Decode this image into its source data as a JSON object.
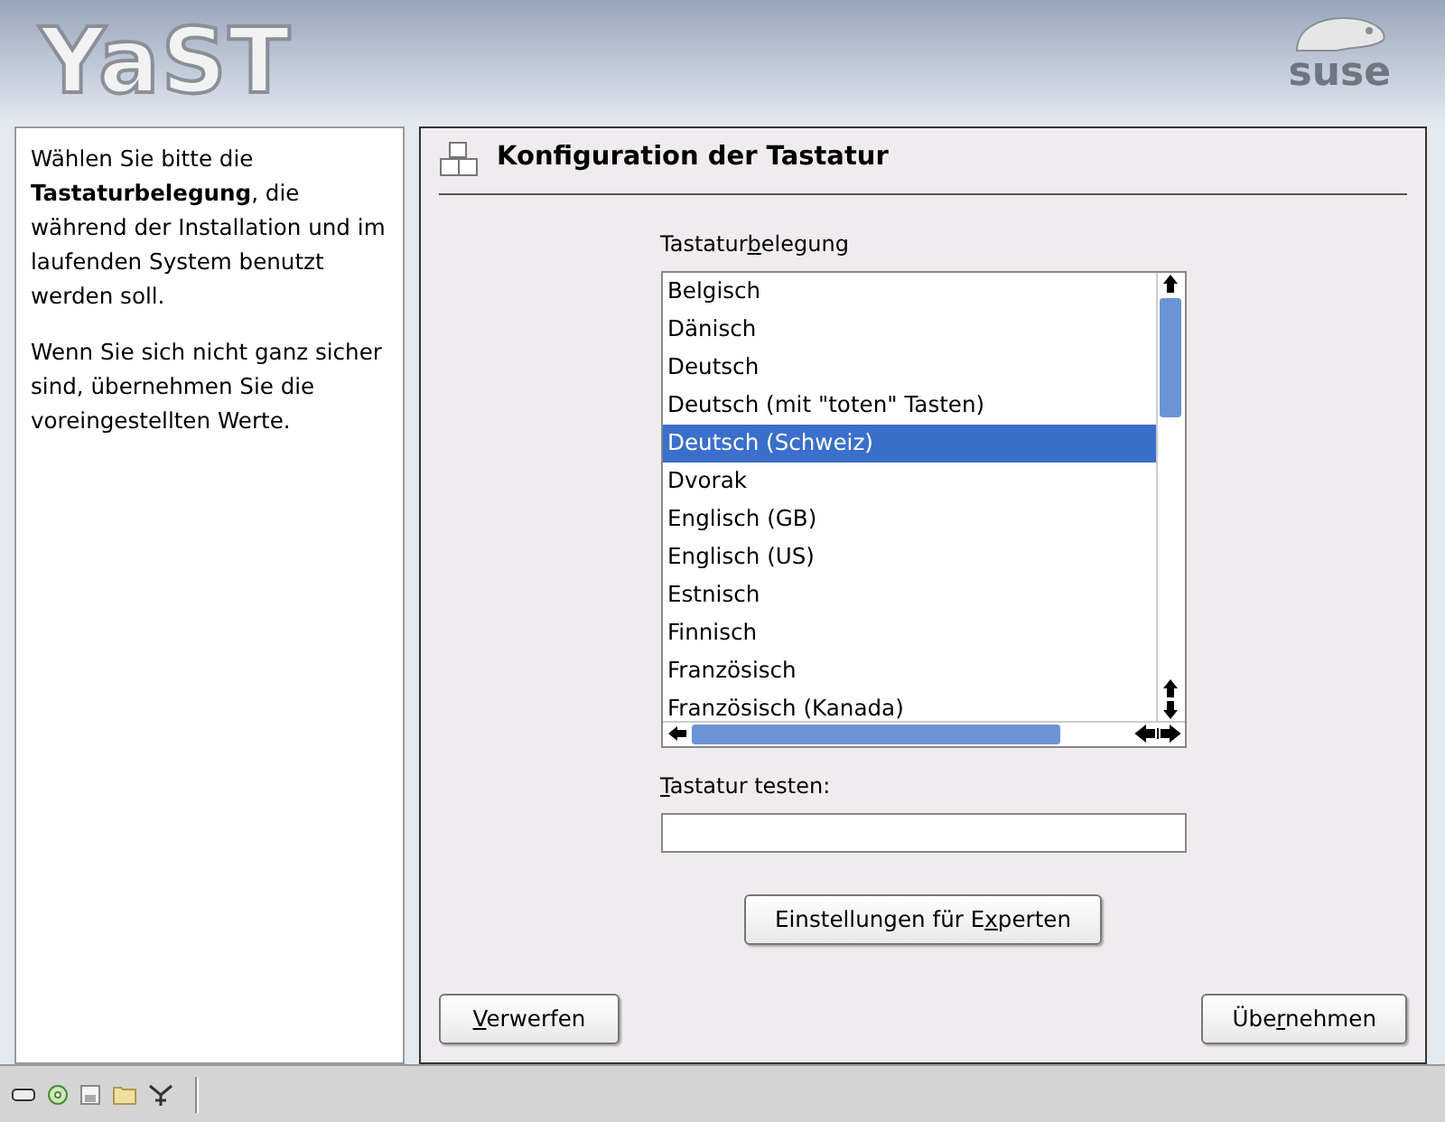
{
  "header": {
    "logo": "YaST",
    "brand": "suse"
  },
  "help": {
    "paragraphs": [
      "Wählen Sie bitte die **Tastaturbelegung**, die während der Installation und im laufenden System benutzt werden soll.",
      "Wenn Sie sich nicht ganz sicher sind, übernehmen Sie die voreingestellten Werte."
    ]
  },
  "dialog": {
    "title": "Konfiguration der Tastatur",
    "layout_list": {
      "label_parts": {
        "before": "Tastatur",
        "key": "b",
        "after": "elegung"
      },
      "items": [
        {
          "label": "Belgisch",
          "selected": false
        },
        {
          "label": "Dänisch",
          "selected": false
        },
        {
          "label": "Deutsch",
          "selected": false
        },
        {
          "label": "Deutsch (mit \"toten\" Tasten)",
          "selected": false
        },
        {
          "label": "Deutsch (Schweiz)",
          "selected": true
        },
        {
          "label": "Dvorak",
          "selected": false
        },
        {
          "label": "Englisch (GB)",
          "selected": false
        },
        {
          "label": "Englisch (US)",
          "selected": false
        },
        {
          "label": "Estnisch",
          "selected": false
        },
        {
          "label": "Finnisch",
          "selected": false
        },
        {
          "label": "Französisch",
          "selected": false
        },
        {
          "label": "Französisch (Kanada)",
          "selected": false
        }
      ]
    },
    "test_field": {
      "label_parts": {
        "key": "T",
        "after": "astatur testen:"
      }
    },
    "expert_button": {
      "label_parts": {
        "before": "Einstellungen für E",
        "key": "x",
        "after": "perten"
      }
    },
    "buttons": [
      {
        "label_parts": {
          "key": "V",
          "after": "erwerfen"
        }
      },
      {
        "label_parts": {
          "before": "Übe",
          "key": "r",
          "after": "nehmen"
        }
      }
    ]
  }
}
